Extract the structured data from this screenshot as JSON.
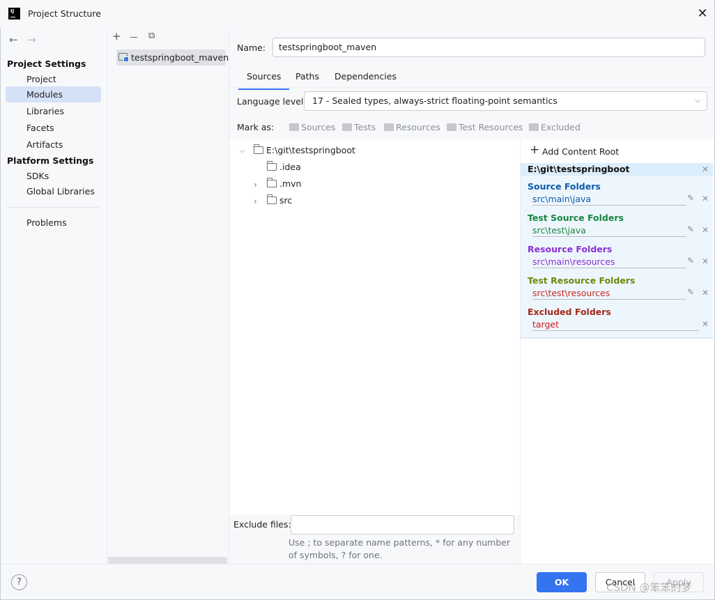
{
  "window": {
    "title": "Project Structure",
    "close": "✕"
  },
  "nav": {
    "back": "←",
    "forward": "→"
  },
  "sidebar": {
    "project_settings_header": "Project Settings",
    "project_settings_items": [
      "Project",
      "Modules",
      "Libraries",
      "Facets",
      "Artifacts"
    ],
    "selected_item": "Modules",
    "platform_settings_header": "Platform Settings",
    "platform_settings_items": [
      "SDKs",
      "Global Libraries"
    ],
    "problems": "Problems"
  },
  "module_list": {
    "toolbar": {
      "add": "+",
      "remove": "—",
      "copy": "⧉"
    },
    "items": [
      "testspringboot_maven"
    ]
  },
  "module": {
    "name_label": "Name:",
    "name_value": "testspringboot_maven",
    "tabs": [
      "Sources",
      "Paths",
      "Dependencies"
    ],
    "active_tab": "Sources",
    "language_level_label": "Language level:",
    "language_level_value": "17 - Sealed types, always-strict floating-point semantics",
    "mark_as_label": "Mark as:",
    "mark_as_options": [
      "Sources",
      "Tests",
      "Resources",
      "Test Resources",
      "Excluded"
    ]
  },
  "tree": {
    "root": "E:\\git\\testspringboot",
    "children": [
      ".idea",
      ".mvn",
      "src"
    ]
  },
  "content_root": {
    "add_label": "Add Content Root",
    "add_icon": "+",
    "path": "E:\\git\\testspringboot",
    "groups": [
      {
        "title": "Source Folders",
        "path": "src\\main\\java",
        "title_color": "#0b5cad",
        "path_color": "#0b5cad"
      },
      {
        "title": "Test Source Folders",
        "path": "src\\test\\java",
        "title_color": "#16863e",
        "path_color": "#16863e"
      },
      {
        "title": "Resource Folders",
        "path": "src\\main\\resources",
        "title_color": "#8a2ed1",
        "path_color": "#8a2ed1"
      },
      {
        "title": "Test Resource Folders",
        "path": "src\\test\\resources",
        "title_color": "#6a8a0a",
        "path_color": "#c4281c"
      },
      {
        "title": "Excluded Folders",
        "path": "target",
        "title_color": "#a12b1a",
        "path_color": "#d1161b"
      }
    ]
  },
  "exclude": {
    "label": "Exclude files:",
    "value": "",
    "hint": "Use ; to separate name patterns, * for any number of symbols, ? for one."
  },
  "footer": {
    "help": "?",
    "ok": "OK",
    "cancel": "Cancel",
    "apply": "Apply"
  },
  "watermark": "CSDN @笨笨的梦",
  "colors": {
    "accent": "#3574f0",
    "selection": "#d5e1f7",
    "content_root_bg": "#eef6fd"
  }
}
